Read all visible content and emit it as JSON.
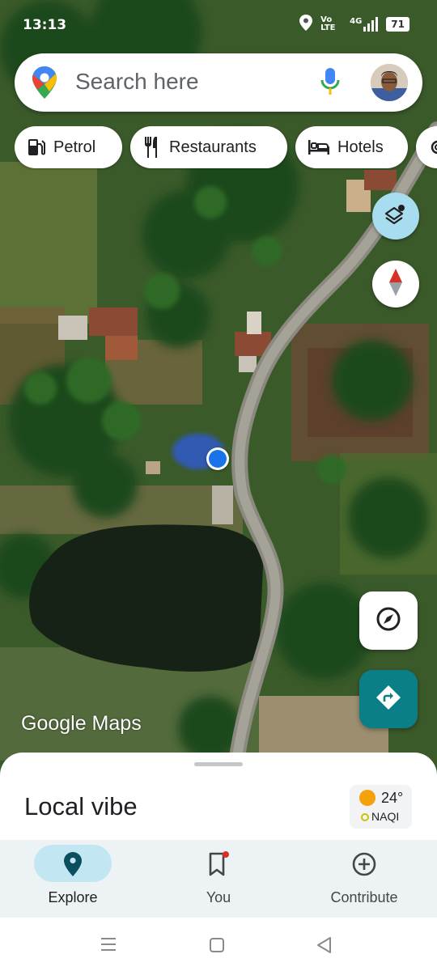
{
  "status_bar": {
    "time": "13:13",
    "network_label": "Vo LTE",
    "signal_label": "4G",
    "battery": "71"
  },
  "search": {
    "placeholder": "Search here"
  },
  "chips": [
    {
      "label": "Petrol",
      "icon": "fuel-icon"
    },
    {
      "label": "Restaurants",
      "icon": "restaurant-icon"
    },
    {
      "label": "Hotels",
      "icon": "hotel-icon"
    }
  ],
  "map": {
    "watermark": "Google Maps",
    "colors": {
      "location_dot": "#1a73e8",
      "directions_fab": "#0b7f88",
      "layers_fab": "#a8dcef"
    }
  },
  "sheet": {
    "title": "Local vibe",
    "weather": {
      "temperature": "24°",
      "aqi": "NAQI"
    }
  },
  "bottom_nav": [
    {
      "label": "Explore",
      "icon": "explore-pin-icon",
      "active": true
    },
    {
      "label": "You",
      "icon": "bookmark-icon",
      "active": false
    },
    {
      "label": "Contribute",
      "icon": "add-circle-icon",
      "active": false
    }
  ]
}
